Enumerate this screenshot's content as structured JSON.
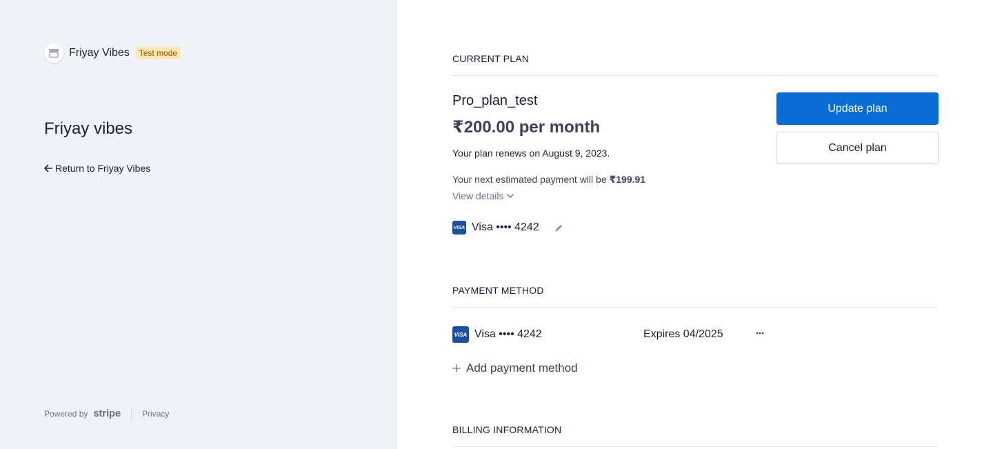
{
  "sidebar": {
    "brand_name": "Friyay Vibes",
    "test_badge": "Test mode",
    "title": "Friyay vibes",
    "return_link": "Return to Friyay Vibes",
    "powered_by": "Powered by",
    "stripe_logo": "stripe",
    "privacy": "Privacy"
  },
  "current_plan": {
    "header": "CURRENT PLAN",
    "plan_name": "Pro_plan_test",
    "price": "₹200.00 per month",
    "renews": "Your plan renews on August 9, 2023.",
    "next_payment_label": "Your next estimated payment will be",
    "next_payment_amount": "₹199.91",
    "view_details": "View details",
    "card": "Visa •••• 4242",
    "update_button": "Update plan",
    "cancel_button": "Cancel plan"
  },
  "payment_method": {
    "header": "PAYMENT METHOD",
    "card": "Visa •••• 4242",
    "expires": "Expires 04/2025",
    "add_label": "Add payment method"
  },
  "billing_information": {
    "header": "BILLING INFORMATION"
  },
  "icons": {
    "visa": "VISA",
    "store": "store-icon",
    "back": "arrow-left-icon",
    "chevron": "chevron-down-icon",
    "edit": "pencil-icon",
    "more": "more-horizontal-icon",
    "add": "plus-icon"
  },
  "colors": {
    "primary_button": "#0a6dd6",
    "sidebar_bg": "#f1f3f8",
    "test_badge_bg": "#fde8b0",
    "test_badge_text": "#a14a10",
    "visa_blue": "#1a4fa0"
  }
}
